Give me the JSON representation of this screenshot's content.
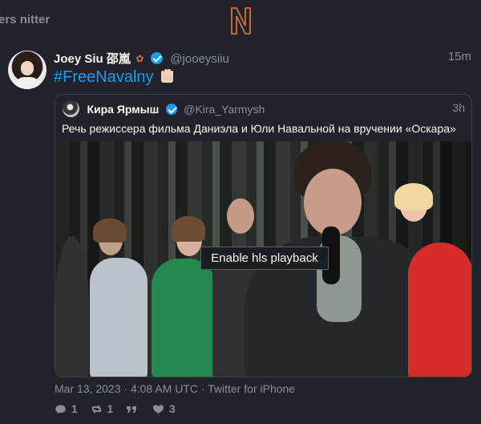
{
  "navbar": {
    "left_text": "ers nitter",
    "logo_letter": "N",
    "logo_color": "#d66f3a"
  },
  "tweet": {
    "author": {
      "fullname": "Joey Siu 邵嵐",
      "username": "@jooeysiiu",
      "verified": true
    },
    "timestamp": "15m",
    "text": "#FreeNavalny",
    "emoji_icon": "raised-fist-icon",
    "quote": {
      "author": {
        "fullname": "Кира Ярмыш",
        "username": "@Kira_Yarmysh",
        "verified": true
      },
      "timestamp": "3h",
      "text": "Речь режиссера фильма Даниэла и Юли Навальной на вручении «Оскара»",
      "video": {
        "button_label": "Enable hls playback"
      }
    },
    "meta": "Mar 13, 2023 · 4:08 AM UTC · Twitter for iPhone",
    "stats": {
      "comments": "1",
      "retweets": "1",
      "quotes": "",
      "likes": "3"
    }
  },
  "colors": {
    "background": "#1a1d22",
    "panel": "#202329",
    "accent": "#1d9bf0",
    "muted": "#8a8f96",
    "border": "#3b3f47"
  }
}
